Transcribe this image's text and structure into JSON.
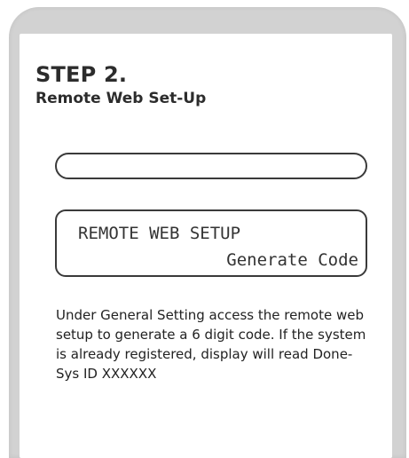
{
  "step": {
    "title": "STEP 2.",
    "subtitle": "Remote Web Set-Up"
  },
  "display": {
    "line1": "REMOTE WEB SETUP",
    "line2": "Generate Code"
  },
  "description": "Under General Setting access the remote web setup to generate a 6 digit code. If the system is already registered, display will read Done-Sys ID XXXXXX"
}
